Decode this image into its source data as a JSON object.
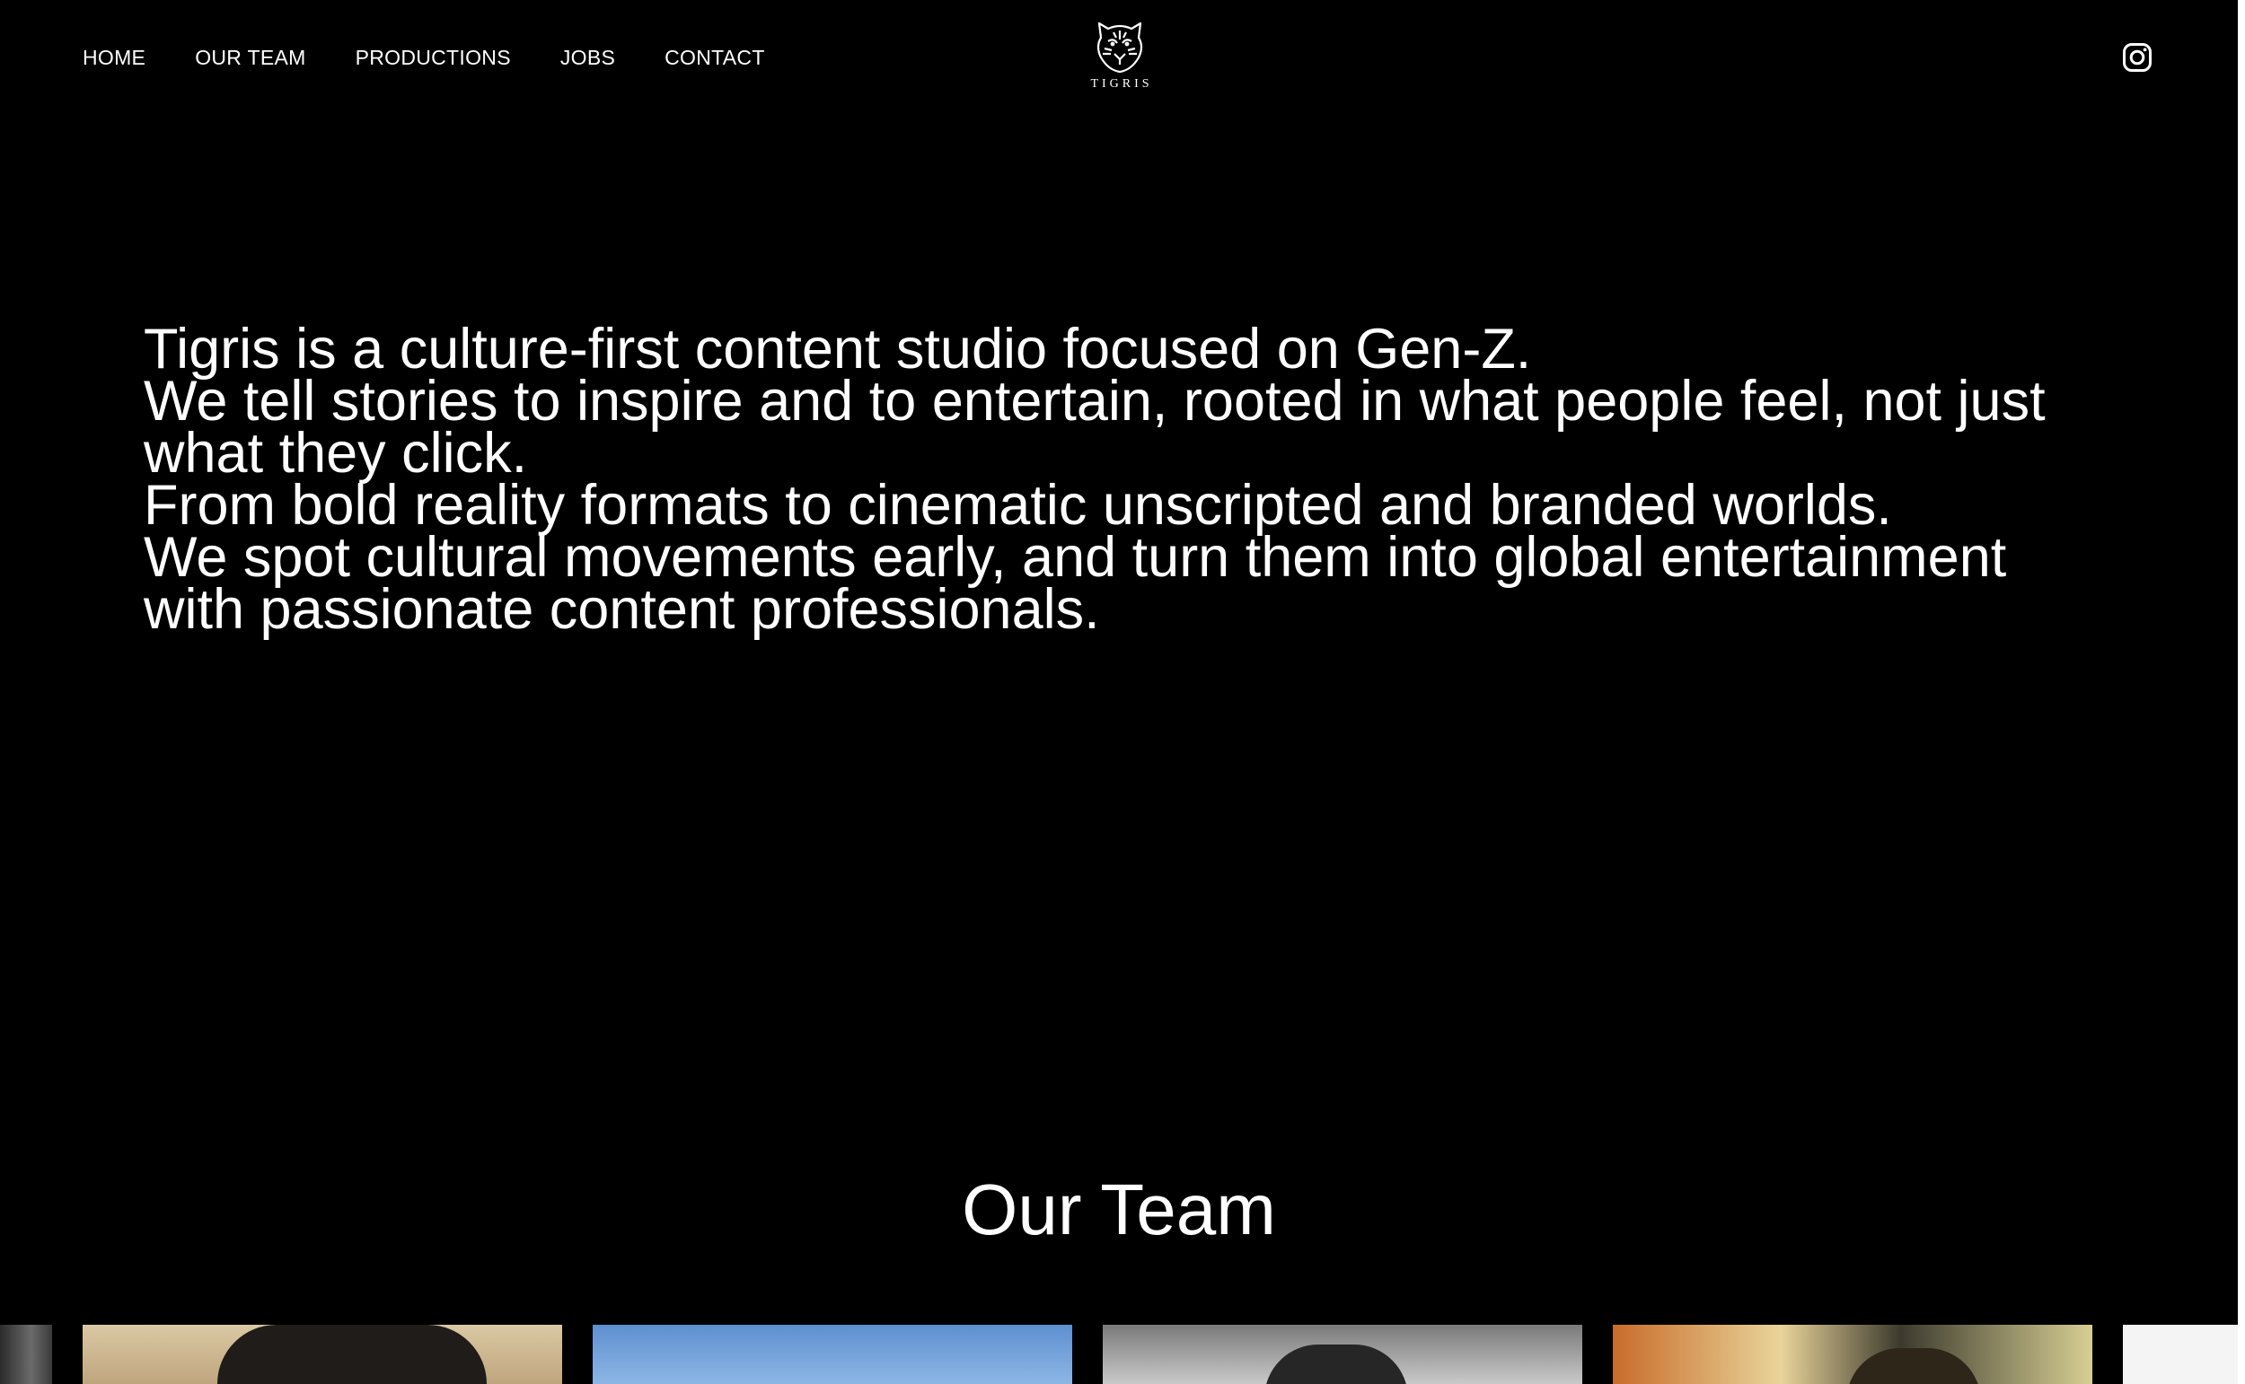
{
  "header": {
    "nav": [
      {
        "label": "HOME"
      },
      {
        "label": "OUR TEAM"
      },
      {
        "label": "PRODUCTIONS"
      },
      {
        "label": "JOBS"
      },
      {
        "label": "CONTACT"
      }
    ],
    "logo": {
      "text": "TIGRIS",
      "icon": "tiger-head-icon"
    },
    "social": {
      "icon": "instagram-icon"
    }
  },
  "hero": {
    "lines": [
      "Tigris is a culture-first content studio focused on Gen-Z.",
      "We tell stories to inspire and to entertain, rooted in what people feel, not just what they click.",
      "From bold reality formats to cinematic unscripted and branded worlds.",
      "We spot cultural movements early, and turn them into global entertainment with passionate content professionals."
    ]
  },
  "team": {
    "title": "Our Team"
  },
  "colors": {
    "background": "#000000",
    "text": "#ffffff"
  }
}
